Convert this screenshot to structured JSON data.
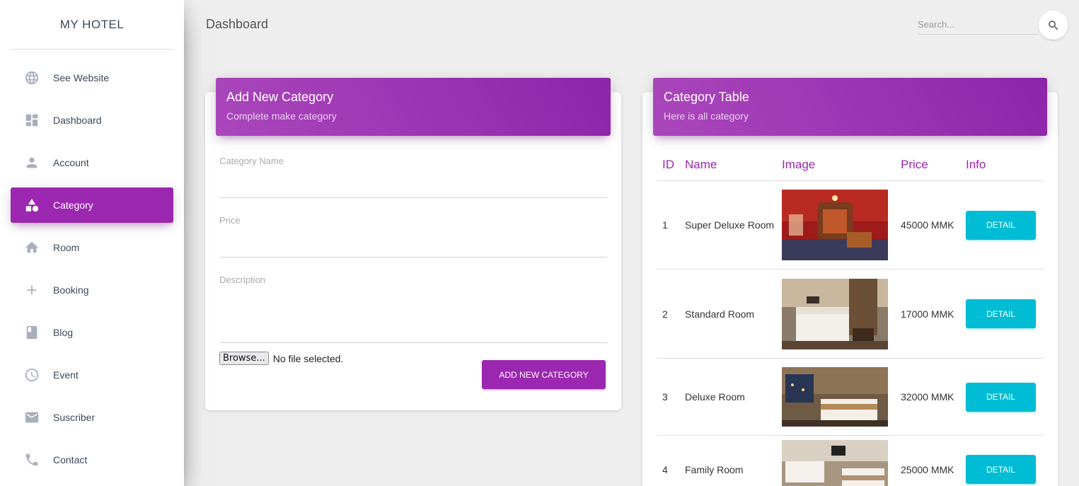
{
  "brand": "MY HOTEL",
  "sidebar": {
    "items": [
      {
        "label": "See Website",
        "icon": "globe-icon"
      },
      {
        "label": "Dashboard",
        "icon": "dashboard-icon"
      },
      {
        "label": "Account",
        "icon": "person-icon"
      },
      {
        "label": "Category",
        "icon": "category-shapes-icon",
        "active": true
      },
      {
        "label": "Room",
        "icon": "home-icon"
      },
      {
        "label": "Booking",
        "icon": "plus-icon"
      },
      {
        "label": "Blog",
        "icon": "book-icon"
      },
      {
        "label": "Event",
        "icon": "clock-icon"
      },
      {
        "label": "Suscriber",
        "icon": "mail-icon"
      },
      {
        "label": "Contact",
        "icon": "phone-icon"
      }
    ]
  },
  "header": {
    "title": "Dashboard",
    "search_placeholder": "Search..."
  },
  "add_form": {
    "title": "Add New Category",
    "subtitle": "Complete make category",
    "name_label": "Category Name",
    "price_label": "Price",
    "description_label": "Description",
    "file_button": "Browse...",
    "file_status": "No file selected.",
    "submit_label": "ADD NEW CATEGORY"
  },
  "table": {
    "title": "Category Table",
    "subtitle": "Here is all category",
    "columns": [
      "ID",
      "Name",
      "Image",
      "Price",
      "Info"
    ],
    "rows": [
      {
        "id": "1",
        "name": "Super Deluxe Room",
        "price": "45000 MMK",
        "action": "DETAIL"
      },
      {
        "id": "2",
        "name": "Standard Room",
        "price": "17000 MMK",
        "action": "DETAIL"
      },
      {
        "id": "3",
        "name": "Deluxe Room",
        "price": "32000 MMK",
        "action": "DETAIL"
      },
      {
        "id": "4",
        "name": "Family Room",
        "price": "25000 MMK",
        "action": "DETAIL"
      }
    ]
  },
  "colors": {
    "primary": "#9c27b0",
    "info": "#00bcd4",
    "background": "#eeeeee"
  }
}
